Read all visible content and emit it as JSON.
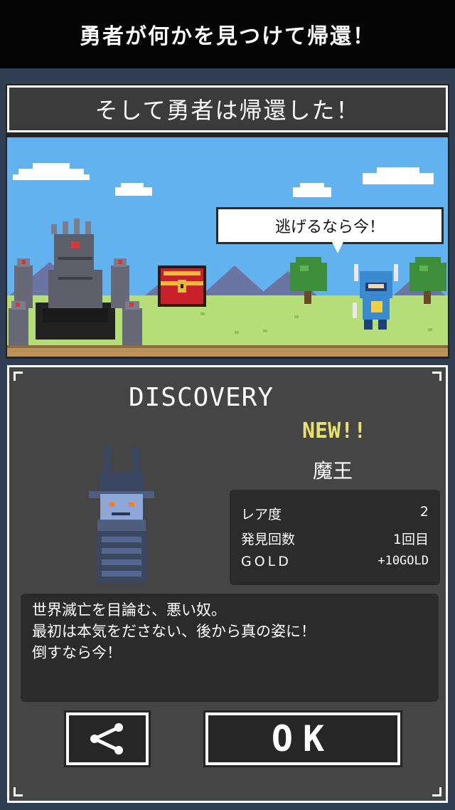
{
  "header": {
    "title": "勇者が何かを見つけて帰還！"
  },
  "stage": {
    "title": "そして勇者は帰還した！",
    "speech": "逃げるなら今！"
  },
  "discovery": {
    "heading": "DISCOVERY",
    "new_badge": "NEW!!",
    "monster_name": "魔王",
    "stats": [
      {
        "label": "レア度",
        "value": "2"
      },
      {
        "label": "発見回数",
        "value": "1回目"
      },
      {
        "label": "GOLD",
        "value": "+10GOLD"
      }
    ],
    "description": [
      "世界滅亡を目論む、悪い奴。",
      "最初は本気をださない、後から真の姿に！",
      "倒すなら今！"
    ],
    "ok_label": "OK"
  },
  "icons": {
    "share": "share-icon",
    "hero": "hero-icon",
    "castle": "castle-icon",
    "chest": "treasure-chest-icon",
    "monster": "demon-king-icon"
  },
  "colors": {
    "new_badge": "#e8e16a",
    "panel": "#454545",
    "sky": "#62b2f0",
    "grass": "#b5dd78"
  }
}
